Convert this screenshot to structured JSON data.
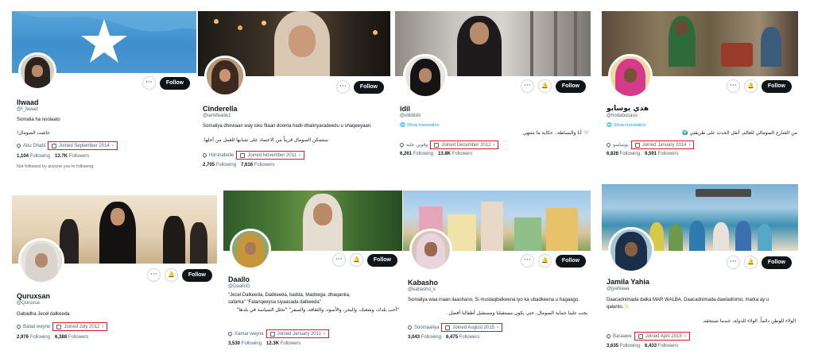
{
  "ui": {
    "follow_label": "Follow",
    "more_icon": "···",
    "bell_icon": "🔔",
    "translate_label": "Show translation",
    "following_word": "Following",
    "followers_word": "Followers",
    "chevron": "›"
  },
  "profiles": [
    {
      "name": "Ilwaad",
      "handle": "@I_lwaad",
      "bio": "Somalia ha noolaato",
      "bio_ar": "عاشت الصومال!",
      "location": "Abu Dhabi",
      "joined": "Joined September 2014",
      "following": "1,104",
      "followers": "13.7K",
      "footer": "Not followed by anyone you're following"
    },
    {
      "name": "Cinderella",
      "handle": "@iamifeade1",
      "bio": "Somaliya dhowaan way isku filaan doonta hadii dhalinyaradeedu u shaqeeyaan.",
      "bio_ar": "ستتمكن الصومال قريباً من الاعتماد على شبابها للعمل من أجلها.",
      "location": "Hiirshabelle",
      "joined": "Joined November 2011",
      "following": "2,705",
      "followers": "7,616"
    },
    {
      "name": "idil",
      "handle": "@idildiiiiiii",
      "bio_ar": "🤍 أنا والبساطة.. حكاية ما بتنتهي",
      "location": "وقوين عليه",
      "joined": "Joined December 2012",
      "following": "6,261",
      "followers": "13.8K",
      "translate": "Show translation"
    },
    {
      "name": "هدي يوسابو",
      "handle": "@hodabosaso",
      "bio_ar": "من الشارع الصومالي للعالم، أنقل الحدث على طريقتي 🌍",
      "location": "بوساسو",
      "joined": "Joined January 2014",
      "following": "6,826",
      "followers": "9,591",
      "translate": "Show translation"
    },
    {
      "name": "Quruxsan",
      "handle": "@Quruxsa",
      "bio": "Gabadha Jecel dalkeeda.",
      "location": "Balad weyne",
      "joined": "Joined July 2012",
      "following": "2,976",
      "followers": "6,388"
    },
    {
      "name": "Daallo",
      "handle": "@DaalloD",
      "bio": "\"Jecel Dalkeeda, Dadkeeda, badda, Madoega, dhaqanka, safarka\" \"Falanqeeysa siyaasada dalkeeda\"",
      "bio_ar": "\"أحب بلدك، وشعبك، والبحر، والأسود، والثقافة، والسفر\" \"تحلل السياسة في بلدها\"",
      "location": "Xamar weyne",
      "joined": "Joined January 2011",
      "following": "3,530",
      "followers": "12.3K"
    },
    {
      "name": "Kabasho",
      "handle": "@kabasho_k",
      "bio": "Somaliya waa inaan ilaashano, Si mustaqbalkeena iyo ka ubadkeena u hagaago.",
      "bio_ar": "يجب علينا حماية الصومال، حتى يكون مستقبلنا ومستقبل أطفالنا أفضل.",
      "location": "Soomaaliya",
      "joined": "Joined August 2015",
      "following": "3,043",
      "followers": "6,475"
    },
    {
      "name": "Jamila Yahia",
      "handle": "@jyahiaaa",
      "bio": "Daacadnimada dalka MAR WALBA. Daacadnimada dawladnimo, marka ay u qalanto.✨",
      "bio_ar": "الولاء للوطن دائماً. الولاء للدولة، عندما تستحقه.",
      "location": "Baraawe",
      "joined": "Joined April 2015",
      "following": "3,635",
      "followers": "6,433"
    }
  ],
  "colors": {
    "highlight": "#e0192c",
    "link": "#1d9bf0",
    "muted": "#536471",
    "text": "#0f1419",
    "button": "#0f1419"
  }
}
